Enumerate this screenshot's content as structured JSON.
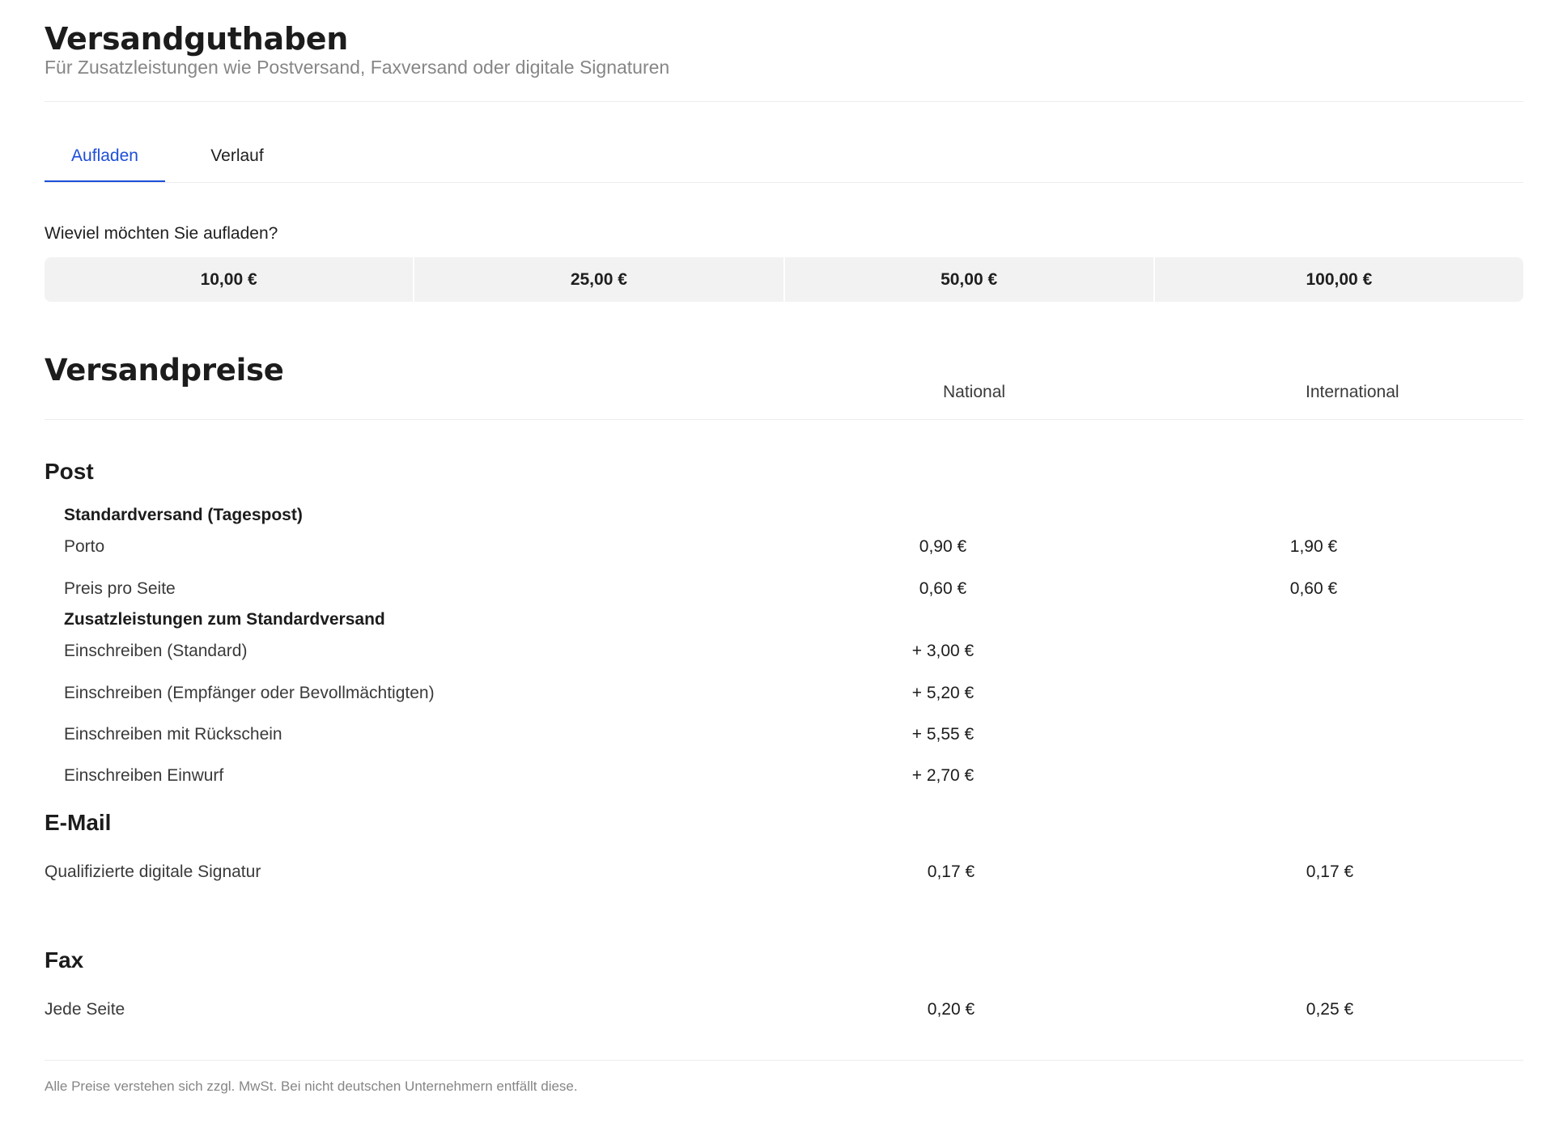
{
  "header": {
    "title": "Versandguthaben",
    "subtitle": "Für Zusatzleistungen wie Postversand, Faxversand oder digitale Signaturen"
  },
  "tabs": [
    {
      "label": "Aufladen",
      "active": true
    },
    {
      "label": "Verlauf",
      "active": false
    }
  ],
  "topup": {
    "question": "Wieviel möchten Sie aufladen?",
    "amounts": [
      "10,00 €",
      "25,00 €",
      "50,00 €",
      "100,00 €"
    ]
  },
  "prices": {
    "title": "Versandpreise",
    "col_national": "National",
    "col_international": "International",
    "post": {
      "title": "Post",
      "standard_title": "Standardversand (Tagespost)",
      "porto": {
        "label": "Porto",
        "national": "0,90 €",
        "international": "1,90 €"
      },
      "per_page": {
        "label": "Preis pro Seite",
        "national": "0,60 €",
        "international": "0,60 €"
      },
      "extras_title": "Zusatzleistungen zum Standardversand",
      "extras": [
        {
          "label": "Einschreiben (Standard)",
          "national": "+ 3,00 €"
        },
        {
          "label": "Einschreiben (Empfänger oder Bevollmächtigten)",
          "national": "+ 5,20 €"
        },
        {
          "label": "Einschreiben mit Rückschein",
          "national": "+ 5,55 €"
        },
        {
          "label": "Einschreiben Einwurf",
          "national": "+ 2,70 €"
        }
      ]
    },
    "email": {
      "title": "E-Mail",
      "signature": {
        "label": "Qualifizierte digitale Signatur",
        "national": "0,17 €",
        "international": "0,17 €"
      }
    },
    "fax": {
      "title": "Fax",
      "page": {
        "label": "Jede Seite",
        "national": "0,20 €",
        "international": "0,25 €"
      }
    }
  },
  "footnote": "Alle Preise verstehen sich zzgl. MwSt. Bei nicht deutschen Unternehmern entfällt diese.",
  "colors": {
    "accent": "#1d4ed8",
    "muted_text": "#868686",
    "button_bg": "#f2f2f2"
  }
}
